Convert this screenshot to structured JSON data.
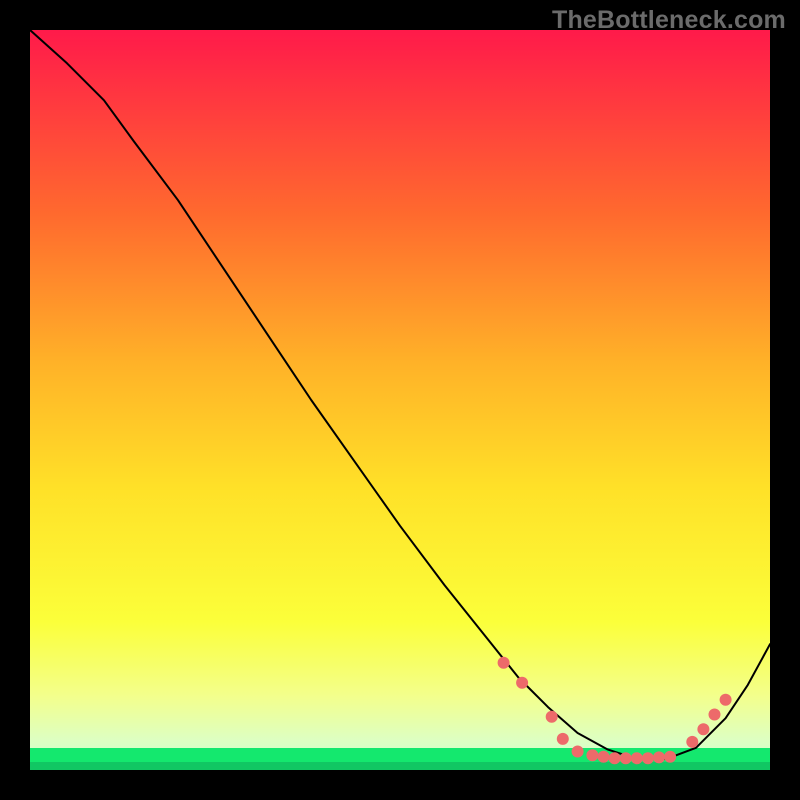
{
  "watermark": "TheBottleneck.com",
  "chart_data": {
    "type": "line",
    "title": "",
    "xlabel": "",
    "ylabel": "",
    "xlim": [
      0,
      100
    ],
    "ylim": [
      0,
      100
    ],
    "background_gradient": {
      "top": "#ff1a4a",
      "mid_upper": "#ff8a2a",
      "mid": "#ffe128",
      "mid_lower": "#f8ff55",
      "lower": "#d7ffba",
      "bottom_band": "#14e86e",
      "bottom_line": "#11c763"
    },
    "curve": {
      "color": "#000000",
      "width": 2,
      "x": [
        0,
        5,
        10,
        14,
        20,
        26,
        32,
        38,
        44,
        50,
        56,
        62,
        66,
        70,
        74,
        78,
        82,
        86,
        90,
        94,
        97,
        100
      ],
      "y": [
        100,
        95.5,
        90.5,
        85,
        77,
        68,
        59,
        50,
        41.5,
        33,
        25,
        17.5,
        12.5,
        8.5,
        5.0,
        2.8,
        1.5,
        1.5,
        3.0,
        7.0,
        11.5,
        17
      ]
    },
    "markers": {
      "color": "#ed6a6a",
      "radius": 6,
      "points": [
        {
          "x": 64.0,
          "y": 14.5
        },
        {
          "x": 66.5,
          "y": 11.8
        },
        {
          "x": 70.5,
          "y": 7.2
        },
        {
          "x": 72.0,
          "y": 4.2
        },
        {
          "x": 74.0,
          "y": 2.5
        },
        {
          "x": 76.0,
          "y": 2.0
        },
        {
          "x": 77.5,
          "y": 1.8
        },
        {
          "x": 79.0,
          "y": 1.6
        },
        {
          "x": 80.5,
          "y": 1.6
        },
        {
          "x": 82.0,
          "y": 1.6
        },
        {
          "x": 83.5,
          "y": 1.6
        },
        {
          "x": 85.0,
          "y": 1.7
        },
        {
          "x": 86.5,
          "y": 1.8
        },
        {
          "x": 89.5,
          "y": 3.8
        },
        {
          "x": 91.0,
          "y": 5.5
        },
        {
          "x": 92.5,
          "y": 7.5
        },
        {
          "x": 94.0,
          "y": 9.5
        }
      ]
    }
  }
}
